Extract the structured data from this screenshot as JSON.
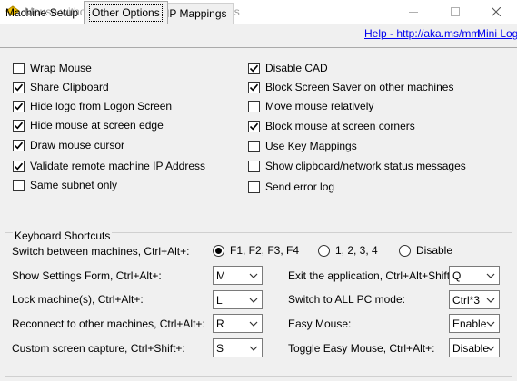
{
  "window": {
    "title": "Mouse without Borders 2.1.8.0105 - Settings",
    "icons": {
      "app": "mouse-without-borders-icon",
      "minimize": "minimize-icon",
      "maximize": "maximize-icon",
      "close": "close-icon"
    }
  },
  "tabs": [
    {
      "label": "Machine Setup",
      "active": false
    },
    {
      "label": "Other Options",
      "active": true
    },
    {
      "label": "IP Mappings",
      "active": false
    }
  ],
  "links": {
    "help": "Help - http://aka.ms/mm",
    "mini_log": "Mini Log"
  },
  "options_left": [
    {
      "label": "Wrap Mouse",
      "checked": false
    },
    {
      "label": "Share Clipboard",
      "checked": true
    },
    {
      "label": "Hide logo from Logon Screen",
      "checked": true
    },
    {
      "label": "Hide mouse at screen edge",
      "checked": true
    },
    {
      "label": "Draw mouse cursor",
      "checked": true
    },
    {
      "label": "Validate remote machine IP Address",
      "checked": true
    },
    {
      "label": "Same subnet only",
      "checked": false
    }
  ],
  "options_right": [
    {
      "label": "Disable CAD",
      "checked": true
    },
    {
      "label": "Block Screen Saver on other machines",
      "checked": true
    },
    {
      "label": "Move mouse relatively",
      "checked": false
    },
    {
      "label": "Block mouse at screen corners",
      "checked": true
    },
    {
      "label": "Use Key Mappings",
      "checked": false
    },
    {
      "label": "Show clipboard/network status messages",
      "checked": false
    },
    {
      "label": "Send error log",
      "checked": false
    }
  ],
  "shortcuts": {
    "group_title": "Keyboard Shortcuts",
    "switch_label": "Switch between machines, Ctrl+Alt+:",
    "switch_options": [
      {
        "label": "F1, F2, F3, F4",
        "selected": true
      },
      {
        "label": "1, 2, 3, 4",
        "selected": false
      },
      {
        "label": "Disable",
        "selected": false
      }
    ],
    "rows_left": [
      {
        "label": "Show Settings Form, Ctrl+Alt+:",
        "value": "M"
      },
      {
        "label": "Lock machine(s), Ctrl+Alt+:",
        "value": "L"
      },
      {
        "label": "Reconnect to other machines, Ctrl+Alt+:",
        "value": "R"
      },
      {
        "label": "Custom screen capture, Ctrl+Shift+:",
        "value": "S"
      }
    ],
    "rows_right": [
      {
        "label": "Exit the application, Ctrl+Alt+Shift+:",
        "value": "Q"
      },
      {
        "label": "Switch to ALL PC mode:",
        "value": "Ctrl*3"
      },
      {
        "label": "Easy Mouse:",
        "value": "Enable"
      },
      {
        "label": "Toggle Easy Mouse, Ctrl+Alt+:",
        "value": "Disable"
      }
    ]
  }
}
